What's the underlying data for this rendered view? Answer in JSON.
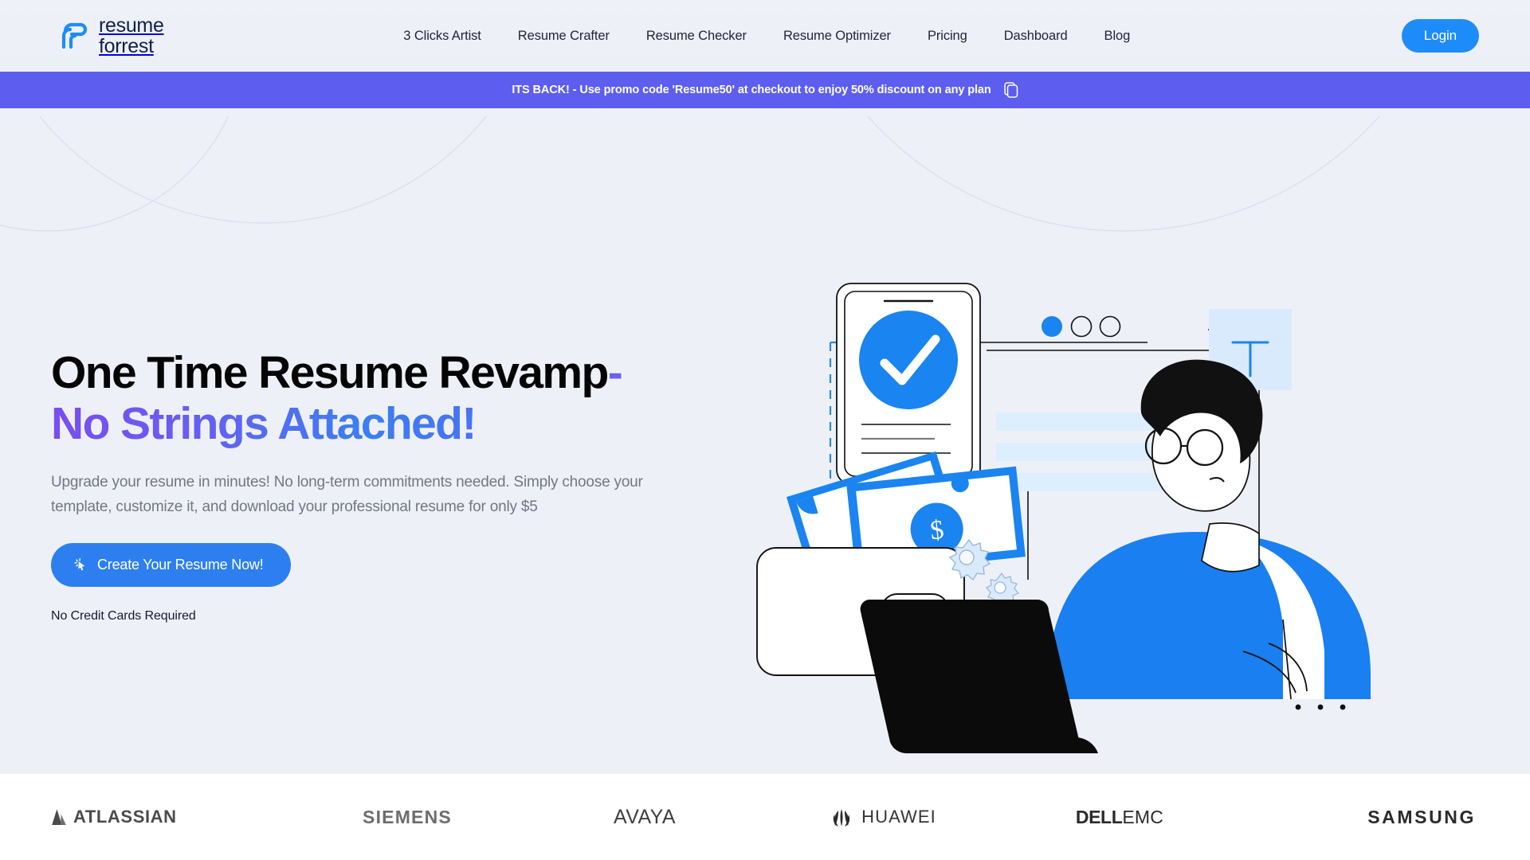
{
  "brand": {
    "line1": "resume",
    "line2": "forrest",
    "mark_icon": "resume-forrest-leaf-icon",
    "mark_color": "#1d8cf8",
    "text_color": "#10204b"
  },
  "nav": {
    "items": [
      {
        "label": "3 Clicks Artist"
      },
      {
        "label": "Resume Crafter"
      },
      {
        "label": "Resume Checker"
      },
      {
        "label": "Resume Optimizer"
      },
      {
        "label": "Pricing"
      },
      {
        "label": "Dashboard"
      },
      {
        "label": "Blog"
      }
    ]
  },
  "header": {
    "login_label": "Login",
    "login_color": "#1d8cf8"
  },
  "promo": {
    "text": "ITS BACK! - Use promo code 'Resume50' at checkout to enjoy 50% discount on any plan",
    "copy_icon": "copy-icon",
    "background": "#5d5ef0",
    "text_color": "#ffffff"
  },
  "hero": {
    "heading_line1": "One Time Resume Revamp",
    "heading_dash": "-",
    "heading_line2": "No Strings Attached!",
    "subheading": "Upgrade your resume in minutes! No long-term commitments needed. Simply choose your template, customize it, and download your professional resume for only $5",
    "cta_label": "Create Your Resume Now!",
    "cta_icon": "cursor-click-icon",
    "cta_color": "#2d7ff0",
    "note": "No Credit Cards Required",
    "gradient_start": "#7a4df0",
    "gradient_mid": "#3c7ef2",
    "gradient_end": "#8a3ef0"
  },
  "illustration": {
    "name": "resume-builder-illustration",
    "elements": [
      "phone-with-checkmark",
      "blue-check-circle",
      "wallet-with-cash",
      "dollar-banknotes",
      "gear-icons",
      "browser-window-dots",
      "text-tool-square",
      "dot-grid",
      "person-at-laptop",
      "laptop"
    ],
    "primary_blue": "#1a84f0",
    "light_blue": "#d9eafc",
    "dark": "#101010"
  },
  "logos": {
    "items": [
      {
        "name": "atlassian",
        "label": "ATLASSIAN"
      },
      {
        "name": "siemens",
        "label": "SIEMENS"
      },
      {
        "name": "avaya",
        "label": "AVAYA"
      },
      {
        "name": "huawei",
        "label": "HUAWEI"
      },
      {
        "name": "dell",
        "label": "DELL",
        "suffix": "EMC"
      },
      {
        "name": "samsung",
        "label": "SAMSUNG"
      }
    ]
  }
}
